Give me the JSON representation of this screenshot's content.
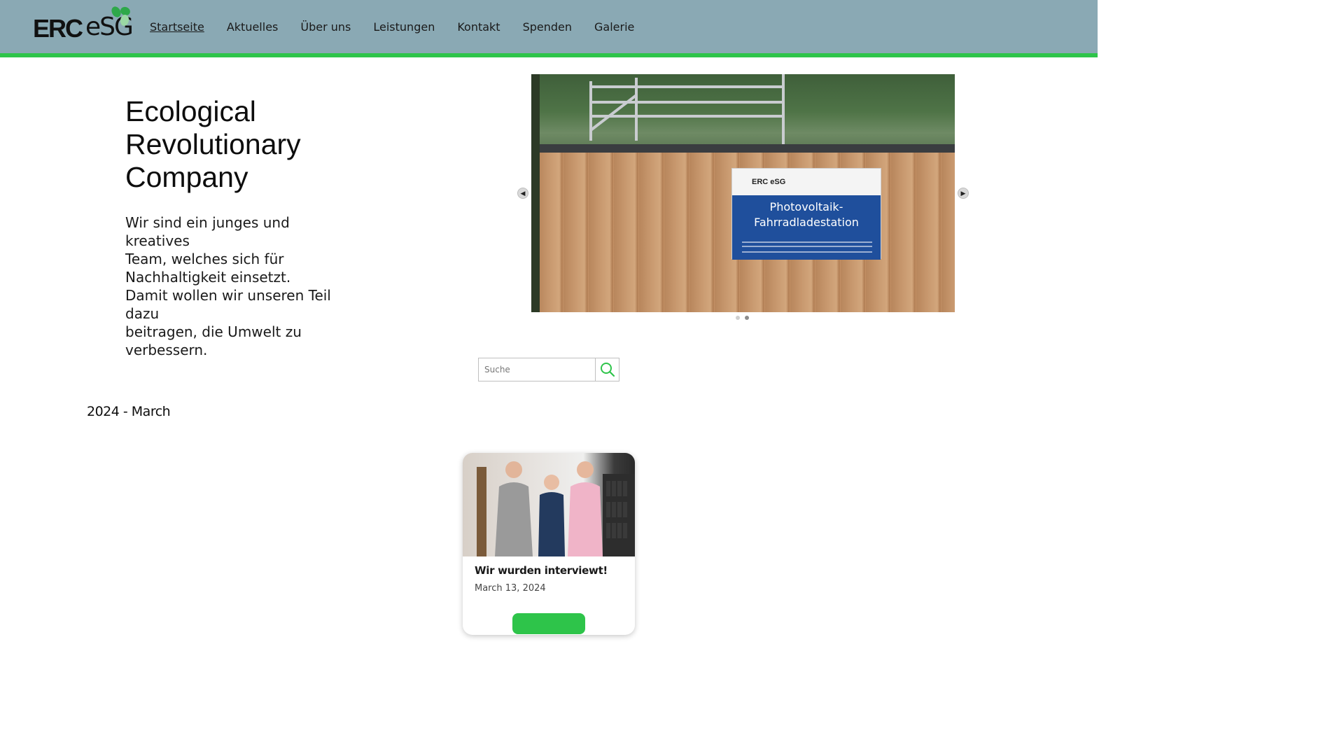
{
  "header": {
    "logo": {
      "erc": "ERC",
      "esg": "eSG"
    },
    "nav": [
      {
        "label": "Startseite",
        "active": true
      },
      {
        "label": "Aktuelles",
        "active": false
      },
      {
        "label": "Über uns",
        "active": false
      },
      {
        "label": "Leistungen",
        "active": false
      },
      {
        "label": "Kontakt",
        "active": false
      },
      {
        "label": "Spenden",
        "active": false
      },
      {
        "label": "Galerie",
        "active": false
      }
    ]
  },
  "hero": {
    "title_lines": [
      "Ecological",
      "Revolutionary",
      "Company"
    ],
    "text_lines": [
      "Wir sind ein junges und kreatives",
      "Team, welches sich für",
      "Nachhaltigkeit einsetzt.",
      "Damit wollen wir unseren Teil dazu",
      "beitragen, die Umwelt zu",
      "verbessern."
    ]
  },
  "slider": {
    "sign_logo": "ERC eSG",
    "sign_title_lines": [
      "Photovoltaik-",
      "Fahrradladestation"
    ],
    "prev_icon": "chevron-left-icon",
    "next_icon": "chevron-right-icon",
    "slides_count": 2,
    "active_slide": 2
  },
  "search": {
    "placeholder": "Suche",
    "value": "",
    "icon": "search-icon"
  },
  "archive": {
    "heading": "2024 - March"
  },
  "posts": [
    {
      "title": "Wir wurden interviewt!",
      "date": "March 13, 2024"
    }
  ],
  "colors": {
    "header_bg": "#8aa9b4",
    "accent_green": "#2ec44a",
    "sign_blue": "#1f4f9c"
  }
}
